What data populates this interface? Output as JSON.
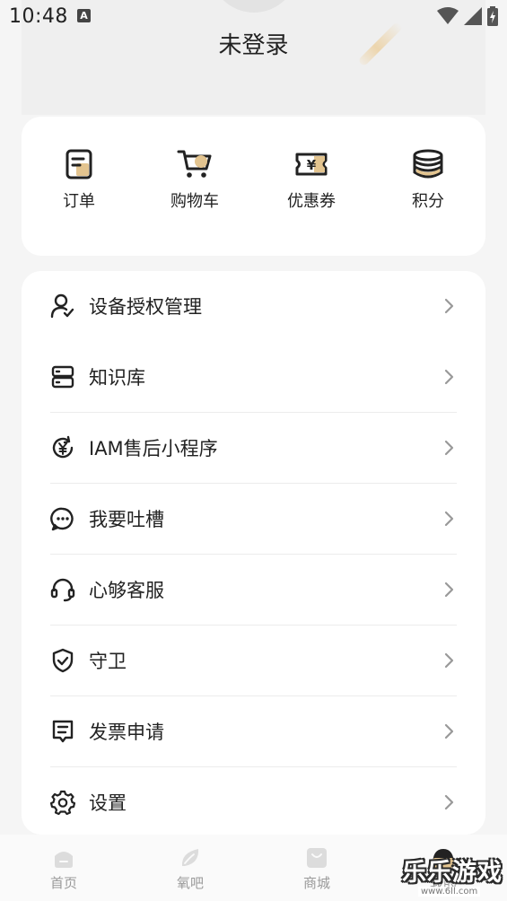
{
  "status_bar": {
    "time": "10:48",
    "notification_letter": "A"
  },
  "header": {
    "title": "未登录"
  },
  "quick_actions": [
    {
      "label": "订单",
      "icon": "order-icon"
    },
    {
      "label": "购物车",
      "icon": "cart-icon"
    },
    {
      "label": "优惠券",
      "icon": "coupon-icon"
    },
    {
      "label": "积分",
      "icon": "points-icon"
    }
  ],
  "menu": [
    {
      "label": "设备授权管理",
      "icon": "user-check-icon"
    },
    {
      "label": "知识库",
      "icon": "server-icon"
    },
    {
      "label": "IAM售后小程序",
      "icon": "yen-refresh-icon"
    },
    {
      "label": "我要吐槽",
      "icon": "chat-bubble-icon"
    },
    {
      "label": "心够客服",
      "icon": "headset-icon"
    },
    {
      "label": "守卫",
      "icon": "shield-icon"
    },
    {
      "label": "发票申请",
      "icon": "invoice-icon"
    },
    {
      "label": "设置",
      "icon": "gear-icon"
    }
  ],
  "bottom_nav": [
    {
      "label": "首页",
      "icon": "home-icon"
    },
    {
      "label": "氧吧",
      "icon": "leaf-icon"
    },
    {
      "label": "商城",
      "icon": "shop-bag-icon"
    },
    {
      "label": "我的",
      "icon": "profile-face-icon"
    }
  ],
  "watermark": {
    "text": "乐乐游戏",
    "url": "www.6ll.com"
  },
  "colors": {
    "accent": "#E3C48F",
    "icon_stroke": "#222222",
    "nav_inactive": "#9A9A9A",
    "background": "#F5F5F5",
    "card": "#FFFFFF"
  }
}
